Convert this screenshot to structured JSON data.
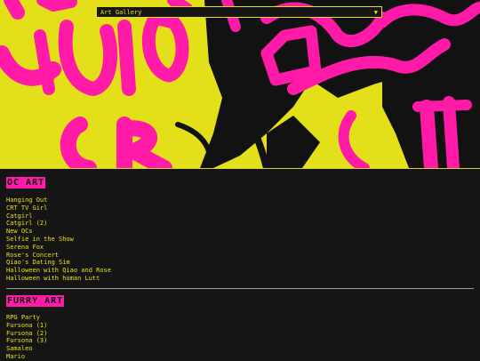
{
  "header": {
    "gallery_select": {
      "value": "Art Gallery",
      "arrow": "▼"
    },
    "colors": {
      "accent_yellow": "#e3e01a",
      "accent_pink": "#ff1aa8",
      "background": "#151515"
    }
  },
  "sections": [
    {
      "title": "OC ART",
      "items": [
        "Hanging Out",
        "CRT TV Girl",
        "Catgirl",
        "Catgirl (2)",
        "New OCs",
        "Selfie in the Show",
        "Serena Fox",
        "Rose's Concert",
        "Qiao's Dating Sim",
        "Halloween with Qiao and Rose",
        "Halloween with human Lutt"
      ]
    },
    {
      "title": "FURRY ART",
      "items": [
        "RPG Party",
        "Fursona (1)",
        "Fursona (2)",
        "Fursona (3)",
        "Samaleo",
        "Mario"
      ]
    }
  ]
}
